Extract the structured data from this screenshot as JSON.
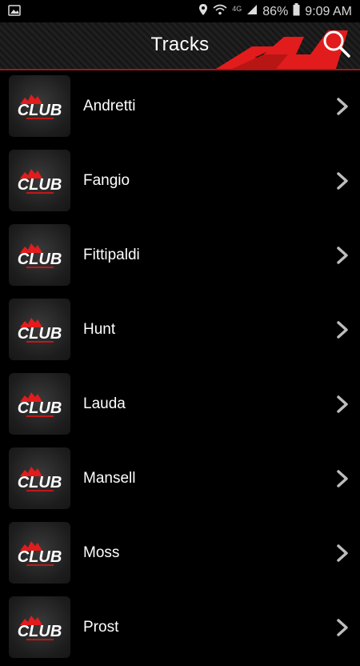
{
  "status_bar": {
    "battery": "86%",
    "time": "9:09 AM",
    "network": "4G"
  },
  "header": {
    "title": "Tracks"
  },
  "logo": {
    "wordmark": "CLUB"
  },
  "tracks": [
    {
      "label": "Andretti"
    },
    {
      "label": "Fangio"
    },
    {
      "label": "Fittipaldi"
    },
    {
      "label": "Hunt"
    },
    {
      "label": "Lauda"
    },
    {
      "label": "Mansell"
    },
    {
      "label": "Moss"
    },
    {
      "label": "Prost"
    }
  ],
  "colors": {
    "accent": "#e21c1c",
    "header_bg": "#1a1a1a"
  },
  "icons": {
    "search": "search-icon",
    "chevron": "chevron-right-icon"
  }
}
